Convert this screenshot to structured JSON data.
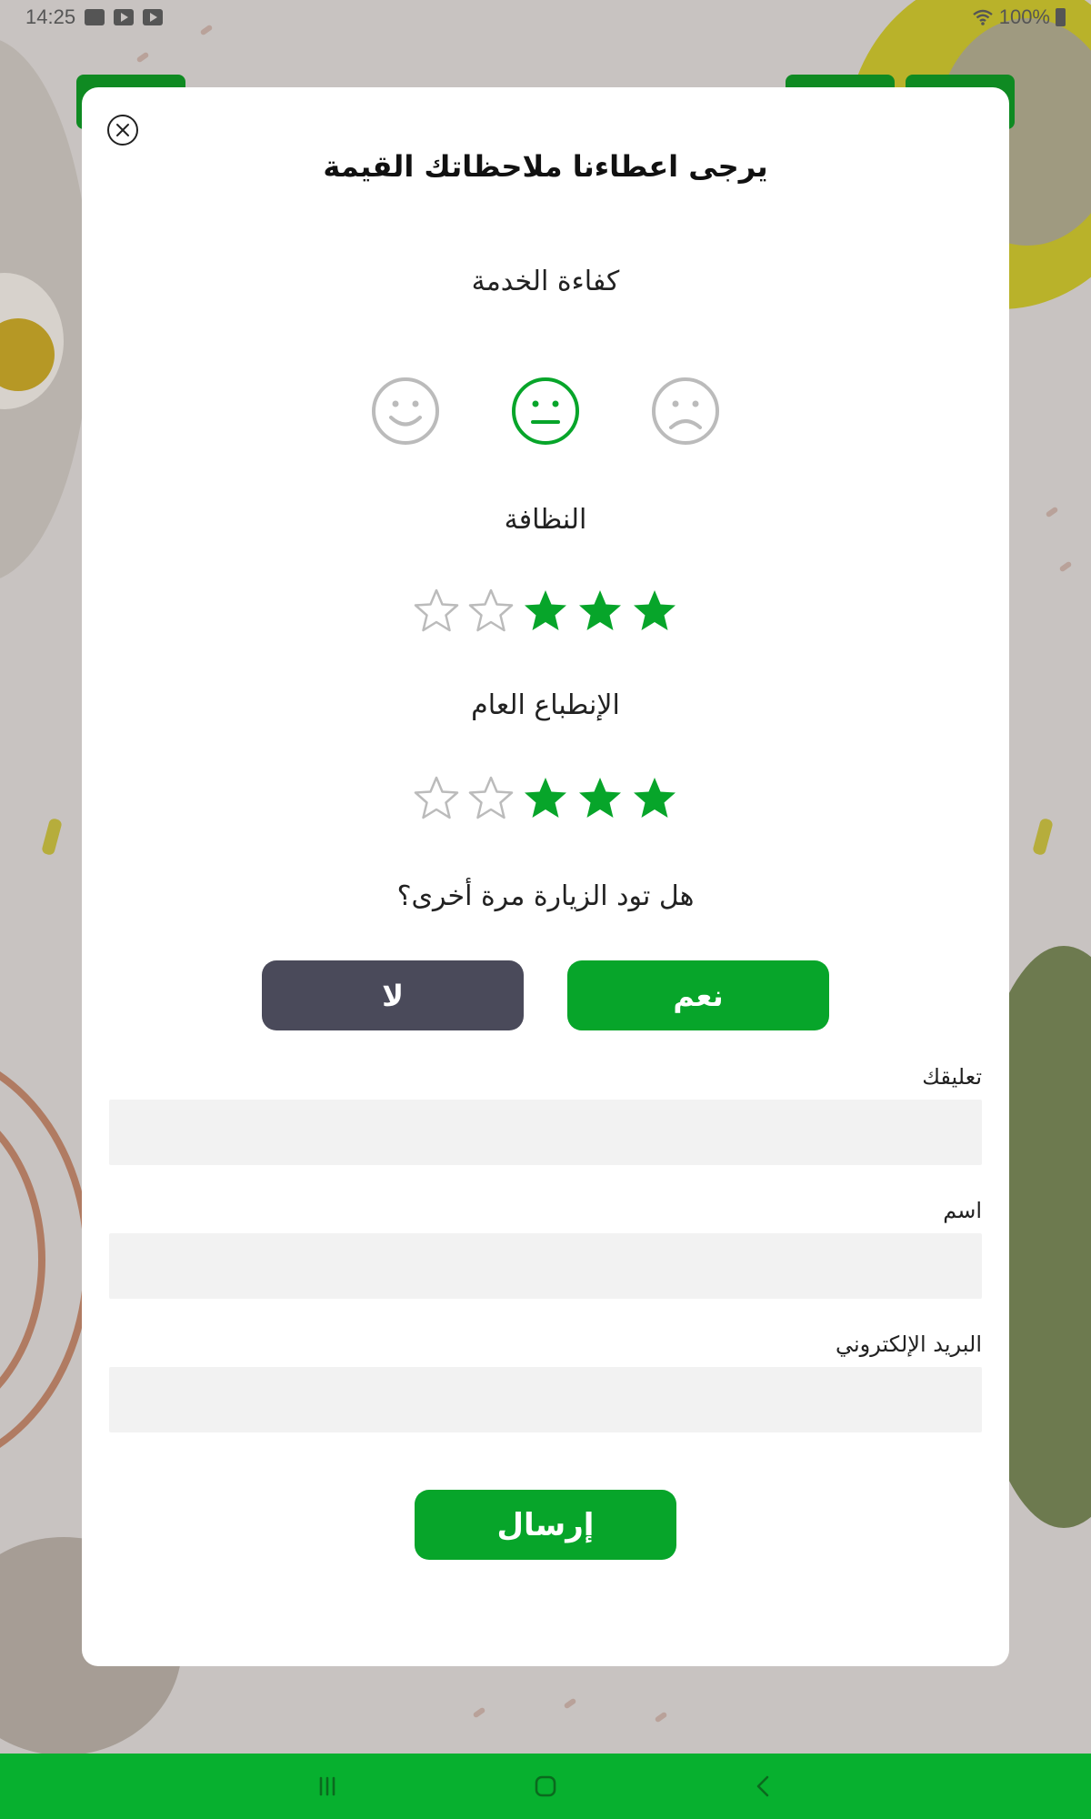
{
  "status_bar": {
    "time": "14:25",
    "battery": "100%",
    "icons": [
      "image-icon",
      "youtube-icon",
      "youtube-icon",
      "wifi-icon",
      "battery-icon"
    ]
  },
  "modal": {
    "title": "يرجى اعطاءنا ملاحظاتك القيمة",
    "service": {
      "label": "كفاءة الخدمة",
      "options": [
        "happy-face-icon",
        "neutral-face-icon",
        "sad-face-icon"
      ],
      "selected": "neutral-face-icon"
    },
    "cleanliness": {
      "label": "النظافة",
      "rating": 3,
      "max": 5
    },
    "overall": {
      "label": "الإنطباع العام",
      "rating": 3,
      "max": 5
    },
    "revisit": {
      "question": "هل تود الزيارة مرة أخرى؟",
      "no_label": "لا",
      "yes_label": "نعم"
    },
    "fields": {
      "comment_label": "تعليقك",
      "comment_value": "",
      "name_label": "اسم",
      "name_value": "",
      "email_label": "البريد الإلكتروني",
      "email_value": ""
    },
    "submit_label": "إرسال"
  },
  "colors": {
    "accent": "#07a52a",
    "no_button": "#4a4a5a",
    "inactive_icon": "#bbbbbb",
    "navbar": "#07b02f"
  },
  "nav_bar": {
    "icons": [
      "recent-apps-icon",
      "home-icon",
      "back-icon"
    ]
  }
}
